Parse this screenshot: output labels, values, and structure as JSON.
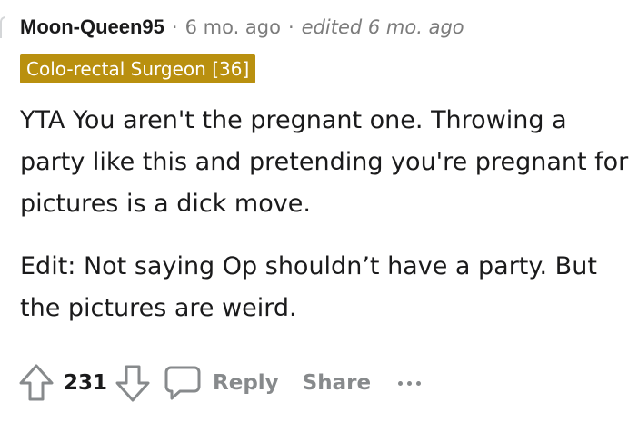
{
  "comment": {
    "author": "Moon-Queen95",
    "separator": "·",
    "time": "6 mo. ago",
    "edited": "edited 6 mo. ago",
    "flair": "Colo-rectal Surgeon [36]",
    "paragraphs": [
      "YTA You aren't the pregnant one. Throwing a party like this and pretending you're pregnant for pictures is a dick move.",
      "Edit: Not saying Op shouldn’t have a party. But the pictures are weird."
    ]
  },
  "actions": {
    "score": "231",
    "reply_label": "Reply",
    "share_label": "Share"
  },
  "icons": {
    "upvote": "upvote-arrow-icon",
    "downvote": "downvote-arrow-icon",
    "reply": "speech-bubble-icon",
    "more": "ellipsis-icon"
  },
  "colors": {
    "flair_bg": "#b9900f",
    "flair_text": "#ffffff",
    "meta_gray": "#7c7c7c",
    "action_gray": "#878a8c"
  }
}
